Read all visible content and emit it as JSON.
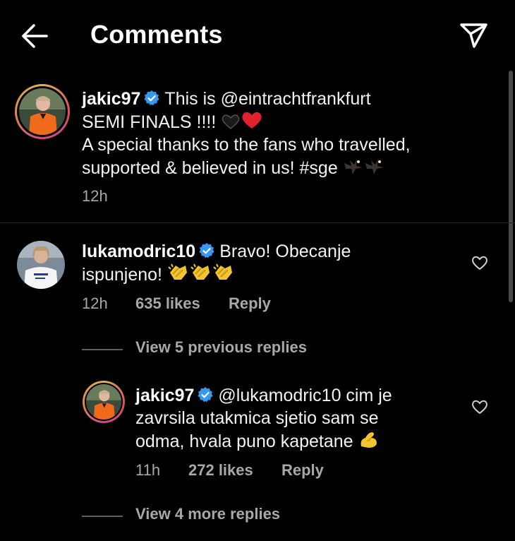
{
  "header": {
    "title": "Comments",
    "back_icon": "arrow-left-icon",
    "send_icon": "paper-plane-icon"
  },
  "post_caption": {
    "username": "jakic97",
    "verified": true,
    "line1": "This is @eintrachtfrankfurt",
    "line2": "SEMI FINALS !!!! ",
    "line3": "A special thanks to the fans who travelled,",
    "line4": "supported & believed in us! #sge ",
    "emojis": [
      "black-heart-emoji",
      "red-heart-emoji",
      "eagle-emoji",
      "eagle-emoji"
    ],
    "time": "12h"
  },
  "comments": [
    {
      "username": "lukamodric10",
      "verified": true,
      "line1": "Bravo! Obecanje",
      "line2": "ispunjeno! ",
      "emojis": [
        "clapping-hands-emoji",
        "clapping-hands-emoji",
        "clapping-hands-emoji"
      ],
      "time": "12h",
      "likes": "635 likes",
      "reply_label": "Reply",
      "view_replies_label": "View 5 previous replies",
      "replies": [
        {
          "username": "jakic97",
          "verified": true,
          "line1": "@lukamodric10 cim je",
          "line2": "zavrsila utakmica sjetio sam se",
          "line3": "odma, hvala puno kapetane ",
          "emojis": [
            "flexed-biceps-emoji"
          ],
          "time": "11h",
          "likes": "272 likes",
          "reply_label": "Reply"
        }
      ],
      "more_replies_label": "View 4 more replies"
    }
  ],
  "colors": {
    "background": "#000000",
    "secondary_text": "#a8a8a8",
    "verified_blue": "#3897f0",
    "story_ring": "#e04f58"
  }
}
